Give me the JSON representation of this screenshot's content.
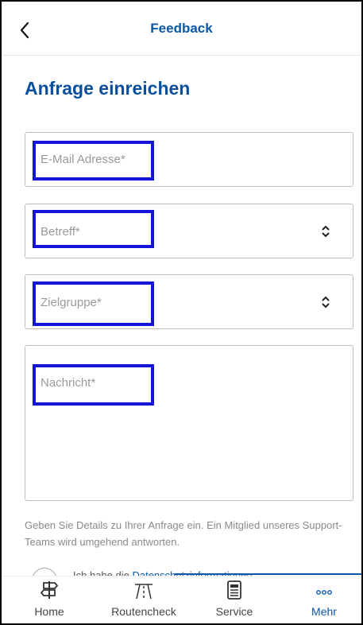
{
  "header": {
    "back_icon": "chevron-left-icon",
    "title": "Feedback"
  },
  "page": {
    "title": "Anfrage einreichen"
  },
  "form": {
    "email_placeholder": "E-Mail Adresse*",
    "subject_placeholder": "Betreff*",
    "audience_placeholder": "Zielgruppe*",
    "message_placeholder": "Nachricht*",
    "hint": "Geben Sie Details zu Ihrer Anfrage ein. Ein Mitglied unseres Support-Teams wird umgehend antworten.",
    "consent_prefix": "Ich habe die",
    "consent_link": "Datenschutzinformationen"
  },
  "highlight_color": "#1414d8",
  "accent_color": "#0a57a8",
  "tabs": [
    {
      "label": "Home",
      "icon": "signpost-icon"
    },
    {
      "label": "Routencheck",
      "icon": "road-icon"
    },
    {
      "label": "Service",
      "icon": "document-icon"
    },
    {
      "label": "Mehr",
      "icon": "more-dots-icon"
    }
  ]
}
